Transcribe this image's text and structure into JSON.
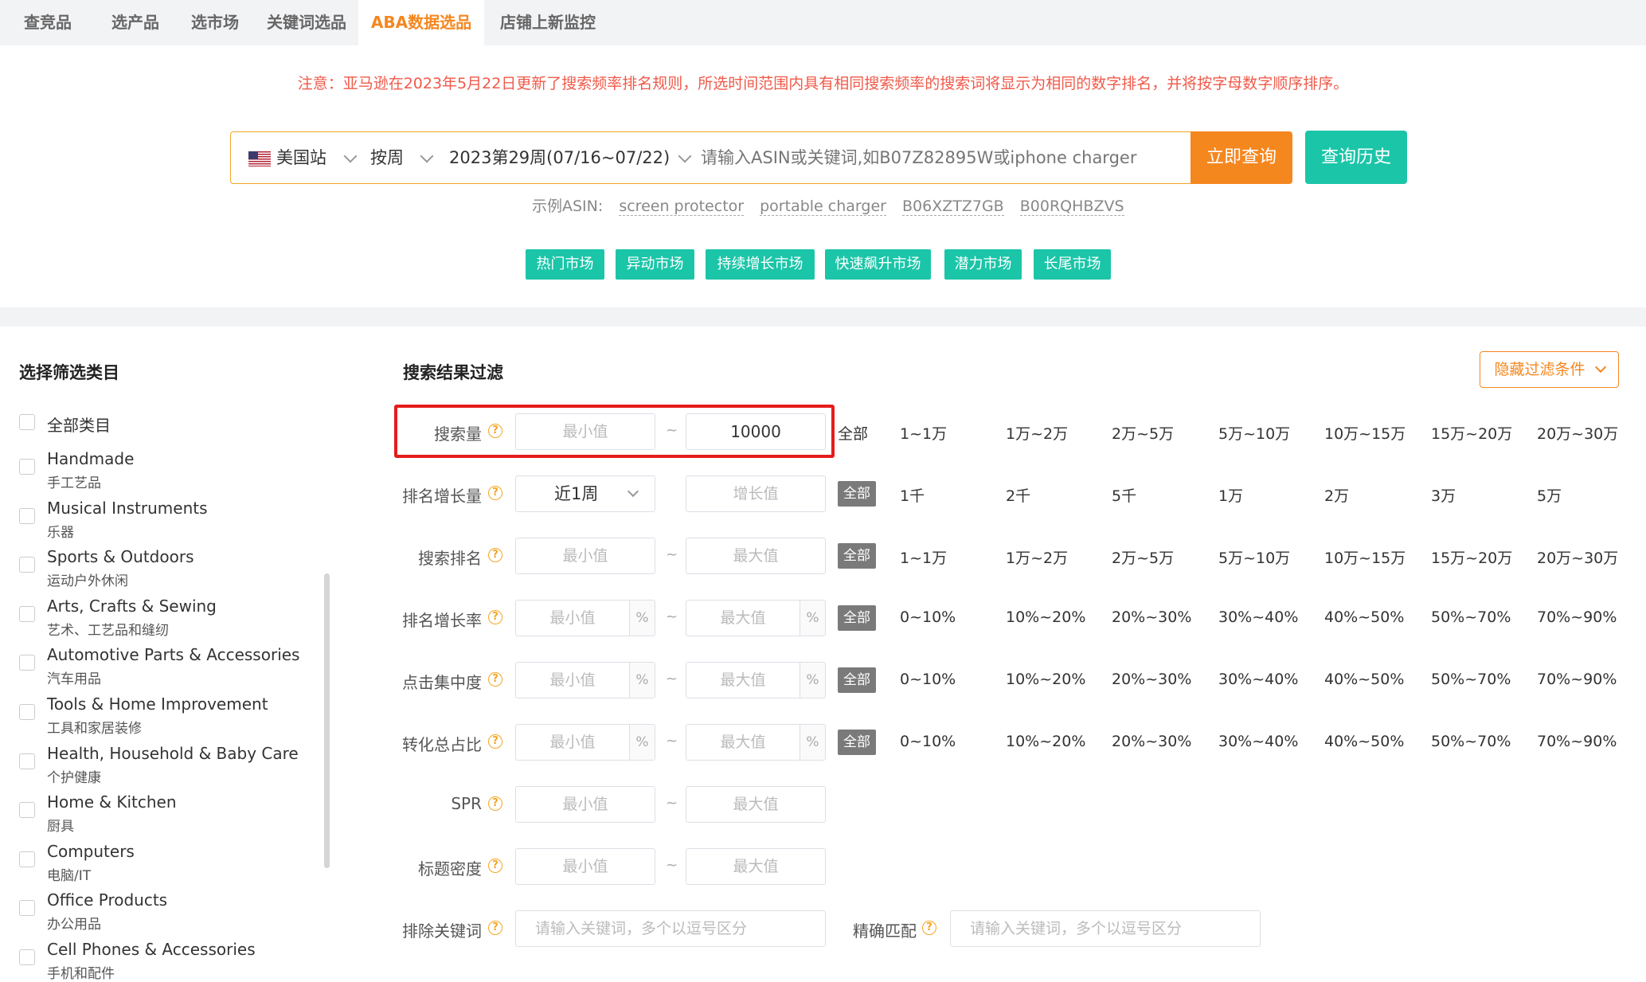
{
  "tabs": [
    {
      "label": "查竞品",
      "active": false
    },
    {
      "label": "选产品",
      "active": false
    },
    {
      "label": "选市场",
      "active": false
    },
    {
      "label": "关键词选品",
      "active": false
    },
    {
      "label": "ABA数据选品",
      "active": true
    },
    {
      "label": "店铺上新监控",
      "active": false
    }
  ],
  "notice": "注意：亚马逊在2023年5月22日更新了搜索频率排名规则，所选时间范围内具有相同搜索频率的搜索词将显示为相同的数字排名，并将按字母数字顺序排序。",
  "search": {
    "site": "美国站",
    "period_type": "按周",
    "week": "2023第29周(07/16~07/22)",
    "placeholder": "请输入ASIN或关键词,如B07Z82895W或iphone charger",
    "query_button": "立即查询",
    "history_button": "查询历史"
  },
  "examples": {
    "label": "示例ASIN:",
    "items": [
      "screen protector",
      "portable charger",
      "B06XZTZ7GB",
      "B00RQHBZVS"
    ]
  },
  "markets": [
    "热门市场",
    "异动市场",
    "持续增长市场",
    "快速飙升市场",
    "潜力市场",
    "长尾市场"
  ],
  "categories": {
    "title": "选择筛选类目",
    "all_label": "全部类目",
    "items": [
      {
        "en": "Handmade",
        "zh": "手工艺品"
      },
      {
        "en": "Musical Instruments",
        "zh": "乐器"
      },
      {
        "en": "Sports & Outdoors",
        "zh": "运动户外休闲"
      },
      {
        "en": "Arts, Crafts & Sewing",
        "zh": "艺术、工艺品和缝纫"
      },
      {
        "en": "Automotive Parts & Accessories",
        "zh": "汽车用品"
      },
      {
        "en": "Tools & Home Improvement",
        "zh": "工具和家居装修"
      },
      {
        "en": "Health, Household & Baby Care",
        "zh": "个护健康"
      },
      {
        "en": "Home & Kitchen",
        "zh": "厨具"
      },
      {
        "en": "Computers",
        "zh": "电脑/IT"
      },
      {
        "en": "Office Products",
        "zh": "办公用品"
      },
      {
        "en": "Cell Phones & Accessories",
        "zh": "手机和配件"
      }
    ]
  },
  "filters": {
    "title": "搜索结果过滤",
    "hide_button": "隐藏过滤条件",
    "help_glyph": "?",
    "tilde": "~",
    "pct": "%",
    "all": "全部",
    "rows": [
      {
        "label": "搜索量",
        "min": "最小值",
        "max": "10000",
        "options": [
          "1~1万",
          "1万~2万",
          "2万~5万",
          "5万~10万",
          "10万~15万",
          "15万~20万",
          "20万~30万"
        ]
      },
      {
        "label": "排名增长量",
        "select": "近1周",
        "max": "增长值",
        "options": [
          "1千",
          "2千",
          "5千",
          "1万",
          "2万",
          "3万",
          "5万"
        ]
      },
      {
        "label": "搜索排名",
        "min": "最小值",
        "max": "最大值",
        "options": [
          "1~1万",
          "1万~2万",
          "2万~5万",
          "5万~10万",
          "10万~15万",
          "15万~20万",
          "20万~30万"
        ]
      },
      {
        "label": "排名增长率",
        "min": "最小值",
        "max": "最大值",
        "options": [
          "0~10%",
          "10%~20%",
          "20%~30%",
          "30%~40%",
          "40%~50%",
          "50%~70%",
          "70%~90%"
        ]
      },
      {
        "label": "点击集中度",
        "min": "最小值",
        "max": "最大值",
        "options": [
          "0~10%",
          "10%~20%",
          "20%~30%",
          "30%~40%",
          "40%~50%",
          "50%~70%",
          "70%~90%"
        ]
      },
      {
        "label": "转化总占比",
        "min": "最小值",
        "max": "最大值",
        "options": [
          "0~10%",
          "10%~20%",
          "20%~30%",
          "30%~40%",
          "40%~50%",
          "50%~70%",
          "70%~90%"
        ]
      },
      {
        "label": "SPR",
        "min": "最小值",
        "max": "最大值"
      },
      {
        "label": "标题密度",
        "min": "最小值",
        "max": "最大值"
      }
    ],
    "exclude_label": "排除关键词",
    "exclude_placeholder": "请输入关键词，多个以逗号区分",
    "exact_label": "精确匹配",
    "exact_placeholder": "请输入关键词，多个以逗号区分"
  },
  "colors": {
    "accent": "#f5871f",
    "teal": "#1bc5a8",
    "notice": "#f05a4a",
    "highlight": "#e51c1c"
  }
}
